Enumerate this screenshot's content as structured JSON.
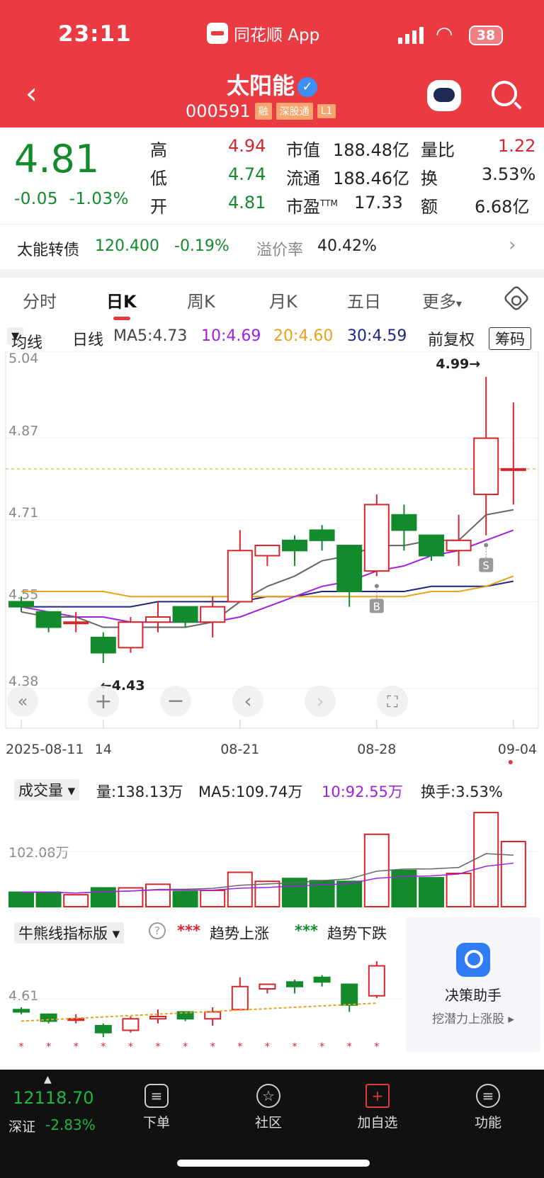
{
  "status_bar": {
    "time": "23:11",
    "app": "同花顺 App",
    "battery": "38"
  },
  "header": {
    "name": "太阳能",
    "code": "000591",
    "tags": [
      "融",
      "深股通",
      "L1"
    ]
  },
  "quote": {
    "price": "4.81",
    "change": "-0.05",
    "change_pct": "-1.03%",
    "high_label": "高",
    "high": "4.94",
    "low_label": "低",
    "low": "4.74",
    "open_label": "开",
    "open": "4.81",
    "mcap_label": "市值",
    "mcap": "188.48亿",
    "float_label": "流通",
    "float": "188.46亿",
    "pe_label": "市盈",
    "pe_sup": "TTM",
    "pe": "17.33",
    "vr_label": "量比",
    "vr": "1.22",
    "turn_label": "换",
    "turn": "3.53%",
    "amt_label": "额",
    "amt": "6.68亿"
  },
  "bond": {
    "name": "太能转债",
    "price": "120.400",
    "pct": "-0.19%",
    "premium_label": "溢价率",
    "premium": "40.42%"
  },
  "tabs": [
    "分时",
    "日K",
    "周K",
    "月K",
    "五日",
    "更多"
  ],
  "ma": {
    "dd": "均线",
    "period": "日线",
    "ma5": "MA5:4.73",
    "ma10": "10:4.69",
    "ma20": "20:4.60",
    "ma30": "30:4.59",
    "adjust": "前复权",
    "chip": "筹码"
  },
  "colors": {
    "up": "#d6262b",
    "down": "#138a2c",
    "ma5": "#666666",
    "ma10": "#a020e0",
    "ma20": "#e8a21b",
    "ma30": "#1f2680"
  },
  "chart_data": {
    "type": "candlestick",
    "dates": [
      "08-11",
      "08-12",
      "08-13",
      "08-14",
      "08-15",
      "08-18",
      "08-19",
      "08-20",
      "08-21",
      "08-22",
      "08-25",
      "08-26",
      "08-27",
      "08-28",
      "08-29",
      "09-01",
      "09-02",
      "09-03",
      "09-04"
    ],
    "candles": [
      [
        4.55,
        4.56,
        4.53,
        4.54
      ],
      [
        4.53,
        4.53,
        4.49,
        4.5
      ],
      [
        4.51,
        4.53,
        4.49,
        4.51
      ],
      [
        4.48,
        4.49,
        4.43,
        4.45
      ],
      [
        4.46,
        4.52,
        4.45,
        4.51
      ],
      [
        4.51,
        4.55,
        4.49,
        4.52
      ],
      [
        4.54,
        4.54,
        4.5,
        4.51
      ],
      [
        4.51,
        4.56,
        4.48,
        4.54
      ],
      [
        4.55,
        4.69,
        4.55,
        4.65
      ],
      [
        4.64,
        4.66,
        4.62,
        4.66
      ],
      [
        4.67,
        4.68,
        4.62,
        4.65
      ],
      [
        4.69,
        4.7,
        4.65,
        4.67
      ],
      [
        4.66,
        4.66,
        4.54,
        4.57
      ],
      [
        4.61,
        4.76,
        4.6,
        4.74
      ],
      [
        4.72,
        4.74,
        4.65,
        4.69
      ],
      [
        4.68,
        4.68,
        4.63,
        4.64
      ],
      [
        4.65,
        4.72,
        4.62,
        4.67
      ],
      [
        4.76,
        4.99,
        4.68,
        4.87
      ],
      [
        4.81,
        4.94,
        4.74,
        4.81
      ]
    ],
    "ma5": [
      4.53,
      4.52,
      4.52,
      4.5,
      4.5,
      4.5,
      4.5,
      4.51,
      4.55,
      4.58,
      4.6,
      4.63,
      4.64,
      4.66,
      4.66,
      4.67,
      4.67,
      4.72,
      4.73
    ],
    "ma10": [
      4.54,
      4.53,
      4.52,
      4.52,
      4.51,
      4.51,
      4.51,
      4.51,
      4.52,
      4.54,
      4.56,
      4.58,
      4.59,
      4.61,
      4.62,
      4.64,
      4.65,
      4.67,
      4.69
    ],
    "ma20": [
      4.57,
      4.57,
      4.57,
      4.57,
      4.56,
      4.56,
      4.56,
      4.56,
      4.56,
      4.56,
      4.56,
      4.56,
      4.56,
      4.56,
      4.56,
      4.57,
      4.57,
      4.58,
      4.6
    ],
    "ma30": [
      4.54,
      4.54,
      4.54,
      4.54,
      4.54,
      4.55,
      4.55,
      4.55,
      4.55,
      4.56,
      4.56,
      4.57,
      4.57,
      4.57,
      4.57,
      4.58,
      4.58,
      4.58,
      4.59
    ],
    "yticks": [
      "5.04",
      "4.87",
      "4.71",
      "4.55",
      "4.38"
    ],
    "ylim": [
      4.38,
      5.04
    ],
    "high_mark": "4.99→",
    "low_mark": "←4.43",
    "xlabels": [
      "2025-08-11",
      "14",
      "08-21",
      "08-28",
      "09-04"
    ],
    "markers": [
      {
        "label": "B",
        "index": 13
      },
      {
        "label": "S",
        "index": 17
      }
    ],
    "volume": {
      "dd": "成交量",
      "label": "量:138.13万",
      "ma5": "MA5:109.74万",
      "ma10": "10:92.55万",
      "turn": "换手:3.53%",
      "ytick": "102.08万",
      "values": [
        40,
        40,
        33,
        52,
        52,
        62,
        42,
        45,
        95,
        70,
        78,
        72,
        70,
        200,
        100,
        80,
        92,
        260,
        180
      ]
    }
  },
  "indicator": {
    "dd": "牛熊线指标版",
    "up_stars": "***",
    "up": "趋势上涨",
    "down_stars": "***",
    "down": "趋势下跌",
    "ytick": "4.61"
  },
  "assistant": {
    "title": "决策助手",
    "sub": "挖潜力上涨股"
  },
  "bottom_nav": {
    "index_value": "12118.70",
    "index_name": "深证",
    "index_pct": "-2.83%",
    "items": [
      "下单",
      "社区",
      "加自选",
      "功能"
    ]
  }
}
